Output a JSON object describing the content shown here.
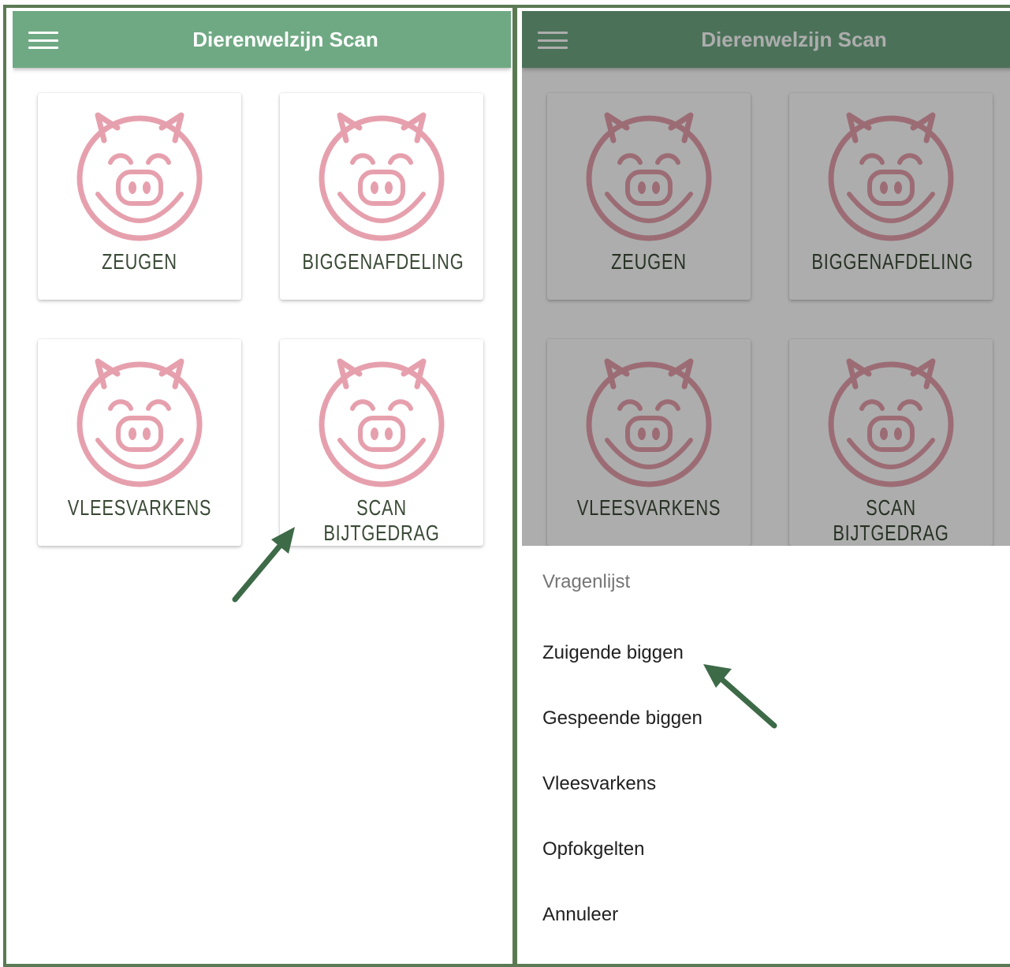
{
  "app": {
    "title": "Dierenwelzijn Scan",
    "menu_icon": "hamburger-menu-icon"
  },
  "tiles": [
    {
      "label": "ZEUGEN",
      "icon": "pig-face-icon"
    },
    {
      "label": "BIGGENAFDELING",
      "icon": "pig-face-icon"
    },
    {
      "label": "VLEESVARKENS",
      "icon": "pig-face-icon"
    },
    {
      "label": "SCAN BIJTGEDRAG",
      "icon": "pig-face-icon"
    }
  ],
  "sheet": {
    "title": "Vragenlijst",
    "items": [
      {
        "label": "Zuigende biggen"
      },
      {
        "label": "Gespeende biggen"
      },
      {
        "label": "Vleesvarkens"
      },
      {
        "label": "Opfokgelten"
      },
      {
        "label": "Annuleer"
      }
    ]
  },
  "colors": {
    "appbar": "#6fa983",
    "pig_icon": "#e6a0ad",
    "tile_label": "#3a4a36",
    "arrow": "#3d6a47",
    "frame": "#5b7a54"
  }
}
